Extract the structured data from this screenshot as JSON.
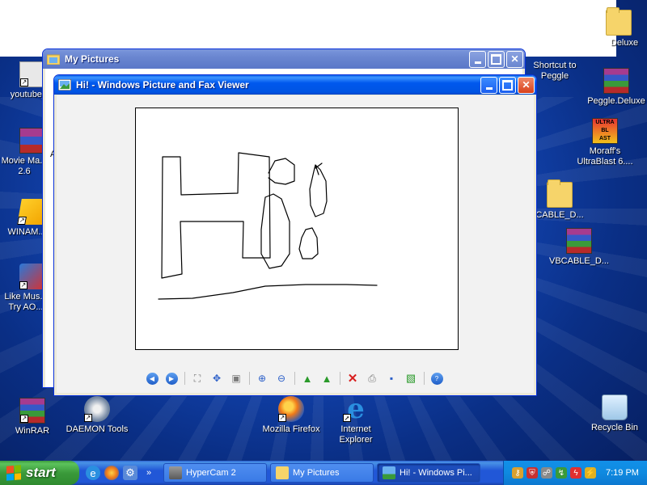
{
  "desktop": {
    "icons_left": [
      {
        "label": "youtube_..."
      },
      {
        "label": "Movie Ma... 2.6"
      },
      {
        "label": "WINAM..."
      },
      {
        "label": "Like Mus... Try AO..."
      },
      {
        "label": "WinRAR"
      },
      {
        "label": "DAEMON Tools"
      },
      {
        "label": "Mozilla Firefox"
      },
      {
        "label": "Internet Explorer"
      }
    ],
    "icons_right": [
      {
        "label": "Deluxe"
      },
      {
        "label": "Shortcut to Peggle"
      },
      {
        "label": "Peggle.Deluxe"
      },
      {
        "label": "Moraff's UltraBlast 6...."
      },
      {
        "label": "CABLE_D..."
      },
      {
        "label": "VBCABLE_D..."
      },
      {
        "label": "Recycle Bin"
      }
    ]
  },
  "my_pictures_window": {
    "title": "My Pictures",
    "partial_text": "A"
  },
  "viewer_window": {
    "title": "Hi! - Windows Picture and Fax Viewer",
    "toolbar_icons": [
      "previous-image-icon",
      "next-image-icon",
      "best-fit-icon",
      "actual-size-icon",
      "slideshow-icon",
      "zoom-in-icon",
      "zoom-out-icon",
      "rotate-clockwise-icon",
      "rotate-counterclockwise-icon",
      "delete-icon",
      "print-icon",
      "save-icon",
      "open-for-editing-icon",
      "help-icon"
    ]
  },
  "taskbar": {
    "start_label": "start",
    "tasks": [
      {
        "label": "HyperCam 2",
        "active": false
      },
      {
        "label": "My Pictures",
        "active": false
      },
      {
        "label": "Hi! - Windows Pi...",
        "active": true
      }
    ],
    "clock": "7:19 PM"
  },
  "colors": {
    "title_bar_active": "#0054e3",
    "taskbar": "#2157d7",
    "start_button": "#3a9a3a",
    "tray": "#0f8ae0"
  }
}
